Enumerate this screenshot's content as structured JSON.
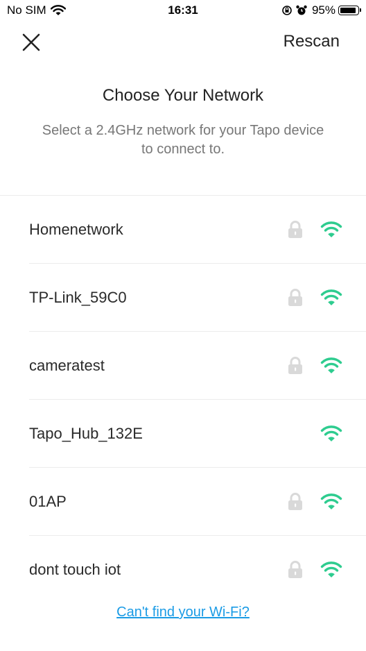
{
  "status_bar": {
    "carrier": "No SIM",
    "time": "16:31",
    "battery_percent": "95%",
    "battery_level": 0.95
  },
  "nav": {
    "close_icon": "close-icon",
    "rescan_label": "Rescan"
  },
  "header": {
    "title": "Choose Your Network",
    "subtitle": "Select a 2.4GHz network for your Tapo device to connect to."
  },
  "networks": [
    {
      "name": "Homenetwork",
      "secured": true
    },
    {
      "name": "TP-Link_59C0",
      "secured": true
    },
    {
      "name": "cameratest",
      "secured": true
    },
    {
      "name": "Tapo_Hub_132E",
      "secured": false
    },
    {
      "name": "01AP",
      "secured": true
    },
    {
      "name": "dont touch iot",
      "secured": true
    }
  ],
  "colors": {
    "wifi_green": "#2ecc8f",
    "lock_gray": "#d9d9d9",
    "link_blue": "#1a9be5"
  },
  "footer": {
    "help_link": "Can't find your Wi-Fi?"
  }
}
